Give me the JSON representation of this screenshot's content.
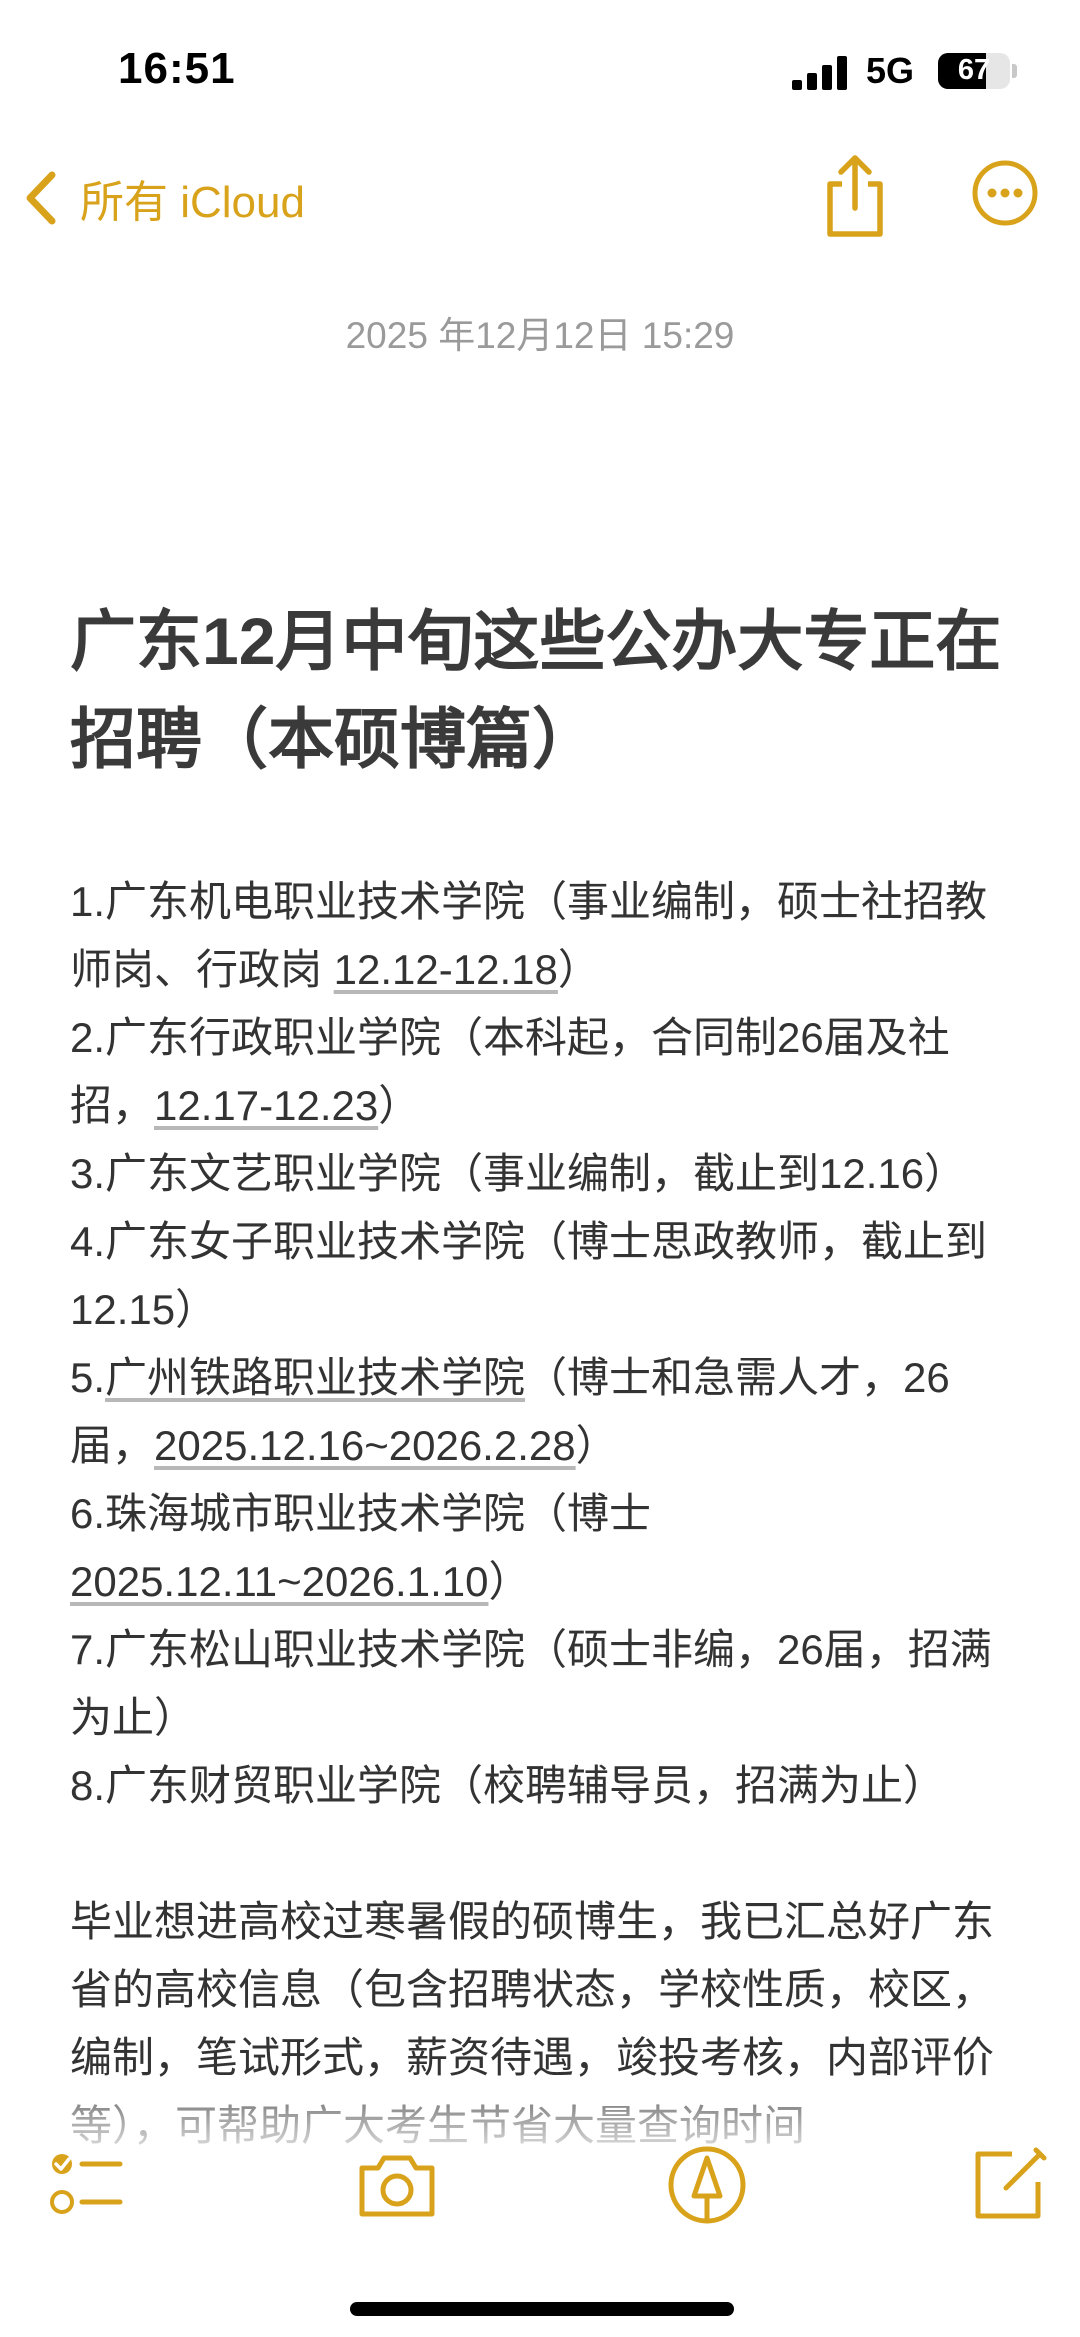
{
  "status_bar": {
    "time": "16:51",
    "network": "5G",
    "battery_percent": "67",
    "battery_level": 0.67
  },
  "nav": {
    "back_label": "所有 iCloud",
    "back_icon": "chevron-left-icon",
    "share_icon": "share-icon",
    "more_icon": "ellipsis-circle-icon"
  },
  "note": {
    "date": "2025 年12月12日 15:29",
    "title": "广东12月中旬这些公办大专正在招聘（本硕博篇）",
    "items": [
      {
        "text": "1.广东机电职业技术学院（事业编制，硕士社招教师岗、行政岗 ",
        "link": "12.12-12.18",
        "after": "）"
      },
      {
        "text": "2.广东行政职业学院（本科起，合同制26届及社招，",
        "link": "12.17-12.23",
        "after": "）"
      },
      {
        "text": "3.广东文艺职业学院（事业编制，截止到12.16）",
        "link": "",
        "after": ""
      },
      {
        "text": "4.广东女子职业技术学院（博士思政教师，截止到12.15）",
        "link": "",
        "after": ""
      },
      {
        "text": "5.",
        "link": "广州铁路职业技术学院",
        "after": "（博士和急需人才，26届，",
        "link2": "2025.12.16~2026.2.28",
        "after2": "）"
      },
      {
        "text": "6.珠海城市职业技术学院（博士",
        "link": "2025.12.11~2026.1.10",
        "after": "）"
      },
      {
        "text": "7.广东松山职业技术学院（硕士非编，26届，招满为止）",
        "link": "",
        "after": ""
      },
      {
        "text": "8.广东财贸职业学院（校聘辅导员，招满为止）",
        "link": "",
        "after": ""
      }
    ],
    "paragraph": "毕业想进高校过寒暑假的硕博生，我已汇总好广东省的高校信息（包含招聘状态，学校",
    "paragraph_faded": "性质，校区，编制，笔试形式，薪资待遇，竣投考核，内部评价等），可帮助广大考生节省大量查询时间"
  },
  "toolbar": {
    "checklist_icon": "checklist-icon",
    "camera_icon": "camera-icon",
    "markup_icon": "pen-markup-icon",
    "compose_icon": "compose-icon"
  },
  "colors": {
    "accent": "#d9a21b",
    "text": "#333333",
    "meta": "#9a9a9a"
  }
}
